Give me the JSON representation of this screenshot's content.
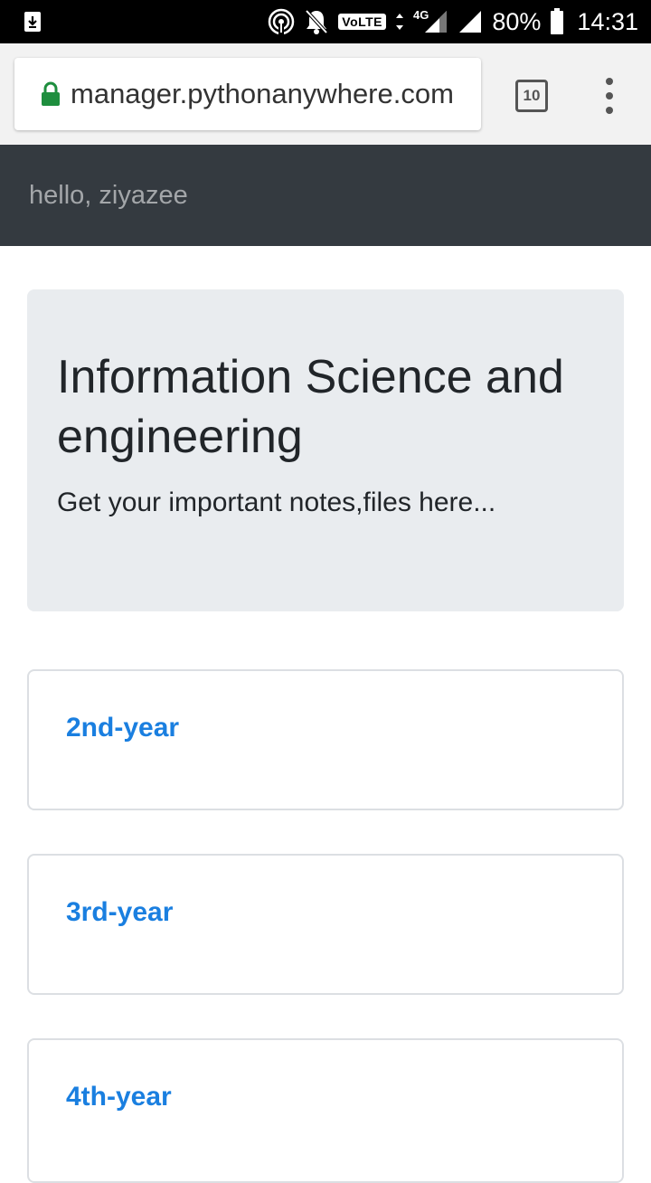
{
  "status_bar": {
    "icons": [
      "download-notification-icon",
      "hotspot-icon",
      "notifications-muted-icon",
      "volte-icon",
      "data-arrows-icon",
      "signal-icon",
      "signal-icon",
      "battery-icon"
    ],
    "volte_label": "VoLTE",
    "network_label": "4G",
    "battery": "80%",
    "time": "14:31"
  },
  "browser": {
    "url": "manager.pythonanywhere.com",
    "tab_count": "10",
    "lock_color": "#1e8e3e"
  },
  "site": {
    "greeting": "hello, ziyazee",
    "nav_color": "#343a40"
  },
  "jumbotron": {
    "title": "Information Science and engineering",
    "lead": "Get your important notes,files here..."
  },
  "years": [
    {
      "label": "2nd-year"
    },
    {
      "label": "3rd-year"
    },
    {
      "label": "4th-year"
    }
  ],
  "link_color": "#1a7fe0"
}
